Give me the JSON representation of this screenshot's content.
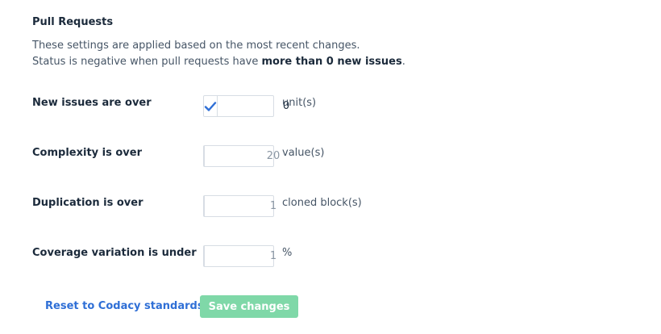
{
  "section": {
    "title": "Pull Requests",
    "desc_line1": "These settings are applied based on the most recent changes.",
    "desc_line2_prefix": "Status is negative when pull requests have ",
    "desc_line2_bold": "more than 0 new issues",
    "desc_line2_suffix": "."
  },
  "rules": [
    {
      "label": "New issues are over",
      "enabled": true,
      "value": "0",
      "unit": "unit(s)"
    },
    {
      "label": "Complexity is over",
      "enabled": false,
      "value": "20",
      "unit": "value(s)"
    },
    {
      "label": "Duplication is over",
      "enabled": false,
      "value": "1",
      "unit": "cloned block(s)"
    },
    {
      "label": "Coverage variation is under",
      "enabled": false,
      "value": "1",
      "unit": "%"
    }
  ],
  "actions": {
    "reset_label": "Reset to Codacy standards",
    "save_label": "Save changes"
  },
  "colors": {
    "check": "#2f6fd6",
    "save_button": "#7fd8a8",
    "link": "#2f6fd6"
  },
  "icons": {
    "checked": "checkmark-icon"
  }
}
